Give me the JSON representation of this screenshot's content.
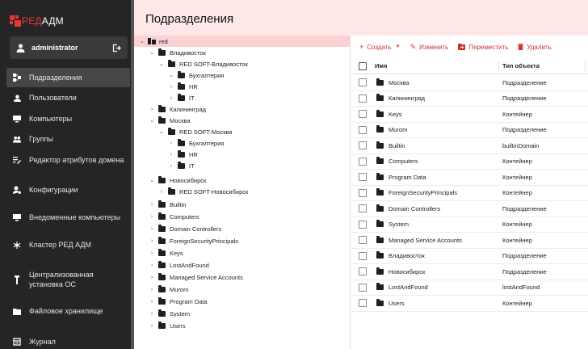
{
  "app": {
    "logo_prefix": "РЕД",
    "logo_suffix": "АДМ",
    "brand_color": "#e53935"
  },
  "user": {
    "name": "administrator",
    "icon": "person-icon",
    "logout_icon": "logout-icon"
  },
  "nav": [
    {
      "label": "Подразделения",
      "icon": "org-units-icon",
      "active": true
    },
    {
      "label": "Пользователи",
      "icon": "person-icon"
    },
    {
      "label": "Компьютеры",
      "icon": "monitor-icon"
    },
    {
      "label": "Группы",
      "icon": "group-icon"
    },
    {
      "label": "Редактор атрибутов домена",
      "icon": "attribute-editor-icon"
    },
    {
      "label": "Конфигурации",
      "icon": "configuration-icon"
    },
    {
      "label": "Внедоменные компьютеры",
      "icon": "monitor-icon"
    },
    {
      "label": "Кластер РЕД АДМ",
      "icon": "cluster-icon"
    },
    {
      "label": "Централизованная установка ОС",
      "icon": "os-install-icon"
    },
    {
      "label": "Файловое хранилище",
      "icon": "folder-icon"
    },
    {
      "label": "Журнал",
      "icon": "journal-icon"
    }
  ],
  "page": {
    "title": "Подразделения"
  },
  "tree": [
    {
      "label": "red",
      "expanded": true,
      "selected": true,
      "icon": "domain-icon"
    },
    {
      "label": "Владивосток",
      "expanded": true
    },
    {
      "label": "RED SOFT-Владивосток",
      "expanded": true
    },
    {
      "label": "Бухгалтерия",
      "expanded": true
    },
    {
      "label": "HR",
      "expanded": false
    },
    {
      "label": "IT",
      "expanded": false
    },
    {
      "label": "Калининград",
      "expanded": false
    },
    {
      "label": "Москва",
      "expanded": true
    },
    {
      "label": "RED SOFT-Москва",
      "expanded": true
    },
    {
      "label": "Бухгалтерия",
      "expanded": false
    },
    {
      "label": "HR",
      "expanded": false
    },
    {
      "label": "IT",
      "expanded": false
    },
    {
      "label": "Новосибирск",
      "expanded": true
    },
    {
      "label": "RED SOFT-Новосибирск",
      "expanded": false
    },
    {
      "label": "Builtin",
      "expanded": false
    },
    {
      "label": "Computers",
      "expanded": false
    },
    {
      "label": "Domain Controllers",
      "expanded": false
    },
    {
      "label": "ForeignSecurityPrincipals",
      "expanded": false
    },
    {
      "label": "Keys",
      "expanded": false
    },
    {
      "label": "LostAndFound",
      "expanded": false
    },
    {
      "label": "Managed Service Accounts",
      "expanded": false
    },
    {
      "label": "Murom",
      "expanded": false
    },
    {
      "label": "Program Data",
      "expanded": false
    },
    {
      "label": "System",
      "expanded": false
    },
    {
      "label": "Users",
      "expanded": false
    }
  ],
  "toolbar": {
    "create": "Создать",
    "edit": "Изменить",
    "move": "Переместить",
    "delete": "Удалить"
  },
  "table": {
    "columns": [
      "Имя",
      "Тип объекта"
    ],
    "rows": [
      {
        "name": "Москва",
        "type": "Подразделение"
      },
      {
        "name": "Калининград",
        "type": "Подразделение"
      },
      {
        "name": "Keys",
        "type": "Контейнер"
      },
      {
        "name": "Murom",
        "type": "Подразделение"
      },
      {
        "name": "Builtin",
        "type": "builtinDomain"
      },
      {
        "name": "Computers",
        "type": "Контейнер"
      },
      {
        "name": "Program Data",
        "type": "Контейнер"
      },
      {
        "name": "ForeignSecurityPrincipals",
        "type": "Контейнер"
      },
      {
        "name": "Domain Controllers",
        "type": "Подразделение"
      },
      {
        "name": "System",
        "type": "Контейнер"
      },
      {
        "name": "Managed Service Accounts",
        "type": "Контейнер"
      },
      {
        "name": "Владивосток",
        "type": "Подразделение"
      },
      {
        "name": "Новосибирск",
        "type": "Подразделение"
      },
      {
        "name": "LostAndFound",
        "type": "lostAndFound"
      },
      {
        "name": "Users",
        "type": "Контейнер"
      }
    ]
  }
}
